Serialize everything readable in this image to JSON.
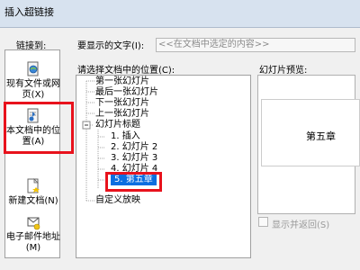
{
  "dialog": {
    "title": "插入超链接",
    "link_to_label": "链接到:",
    "display_text_label": "要显示的文字(I):",
    "display_text_value": "<<在文档中选定的内容>>",
    "place_label": "请选择文档中的位置(C):",
    "preview_label": "幻灯片预览:",
    "show_return_label": "显示并返回(S)"
  },
  "link_options": [
    {
      "label": "现有文件或网页(X)",
      "icon": "web-page-icon",
      "selected": false
    },
    {
      "label": "本文档中的位置(A)",
      "icon": "document-place-icon",
      "selected": true
    },
    {
      "label": "新建文档(N)",
      "icon": "new-document-icon",
      "selected": false
    },
    {
      "label": "电子邮件地址(M)",
      "icon": "email-icon",
      "selected": false
    }
  ],
  "tree": {
    "items": [
      "第一张幻灯片",
      "最后一张幻灯片",
      "下一张幻灯片",
      "上一张幻灯片",
      "幻灯片标题",
      "1. 插入",
      "2. 幻灯片 2",
      "3. 幻灯片 3",
      "4. 幻灯片 4",
      "5. 第五章",
      "自定义放映"
    ],
    "selected": "5. 第五章"
  },
  "preview": {
    "slide_text": "第五章"
  },
  "colors": {
    "highlight_red": "#e8121c",
    "selection_blue": "#0b6ee0"
  }
}
